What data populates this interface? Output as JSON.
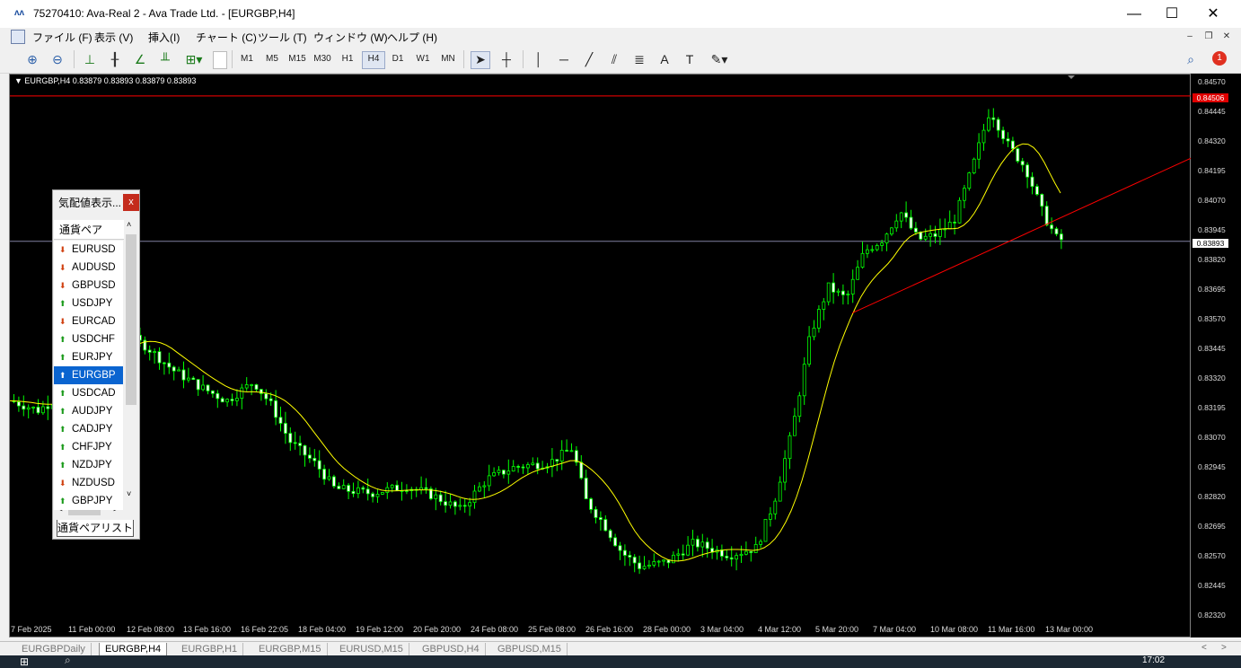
{
  "window": {
    "title": "75270410: Ava-Real 2 - Ava Trade Ltd. - [EURGBP,H4]",
    "minimize": "—",
    "maximize": "☐",
    "close": "✕"
  },
  "menu": [
    "ファイル (F)",
    "表示 (V)",
    "挿入(I)",
    "チャート (C)",
    "ツール (T)",
    "ウィンドウ (W)",
    "ヘルプ (H)"
  ],
  "toolbar": {
    "timeframes": [
      "M1",
      "M5",
      "M15",
      "M30",
      "H1",
      "H4",
      "D1",
      "W1",
      "MN"
    ],
    "active_timeframe": "H4",
    "notification_count": "1"
  },
  "chart": {
    "header": "EURGBP,H4  0.83879 0.83893 0.83879 0.83893",
    "price_labels": [
      "0.84570",
      "0.84445",
      "0.84320",
      "0.84195",
      "0.84070",
      "0.83945",
      "0.83820",
      "0.83695",
      "0.83570",
      "0.83445",
      "0.83320",
      "0.83195",
      "0.83070",
      "0.82945",
      "0.82820",
      "0.82695",
      "0.82570",
      "0.82445",
      "0.82320"
    ],
    "red_level_label": "0.84506",
    "current_price_label": "0.83893",
    "time_labels": [
      "7 Feb 2025",
      "11 Feb 00:00",
      "12 Feb 08:00",
      "13 Feb 16:00",
      "16 Feb 22:05",
      "18 Feb 04:00",
      "19 Feb 12:00",
      "20 Feb 20:00",
      "24 Feb 08:00",
      "25 Feb 08:00",
      "26 Feb 16:00",
      "28 Feb 00:00",
      "3 Mar 04:00",
      "4 Mar 12:00",
      "5 Mar 20:00",
      "7 Mar 04:00",
      "10 Mar 08:00",
      "11 Mar 16:00",
      "13 Mar 00:00"
    ],
    "colors": {
      "bull": "#00ff00",
      "bear": "#ffffff",
      "ma": "#ffff00",
      "trend": "#ff0000",
      "bid": "#8080a0"
    }
  },
  "market_watch": {
    "title": "気配値表示...",
    "close": "x",
    "header": "通貨ペア",
    "tab": "通貨ペアリスト",
    "items": [
      {
        "symbol": "EURUSD",
        "dir": "down"
      },
      {
        "symbol": "AUDUSD",
        "dir": "down"
      },
      {
        "symbol": "GBPUSD",
        "dir": "down"
      },
      {
        "symbol": "USDJPY",
        "dir": "up"
      },
      {
        "symbol": "EURCAD",
        "dir": "down"
      },
      {
        "symbol": "USDCHF",
        "dir": "up"
      },
      {
        "symbol": "EURJPY",
        "dir": "up"
      },
      {
        "symbol": "EURGBP",
        "dir": "up",
        "selected": true
      },
      {
        "symbol": "USDCAD",
        "dir": "up"
      },
      {
        "symbol": "AUDJPY",
        "dir": "up"
      },
      {
        "symbol": "CADJPY",
        "dir": "up"
      },
      {
        "symbol": "CHFJPY",
        "dir": "up"
      },
      {
        "symbol": "NZDJPY",
        "dir": "up"
      },
      {
        "symbol": "NZDUSD",
        "dir": "down"
      },
      {
        "symbol": "GBPJPY",
        "dir": "up"
      }
    ]
  },
  "chart_tabs": [
    "EURGBPDaily",
    "EURGBP,H4",
    "EURGBP,H1",
    "EURGBP,M15",
    "EURUSD,M15",
    "GBPUSD,H4",
    "GBPUSD,M15"
  ],
  "active_chart_tab": "EURGBP,H4",
  "taskbar": {
    "clock": "17:02"
  }
}
